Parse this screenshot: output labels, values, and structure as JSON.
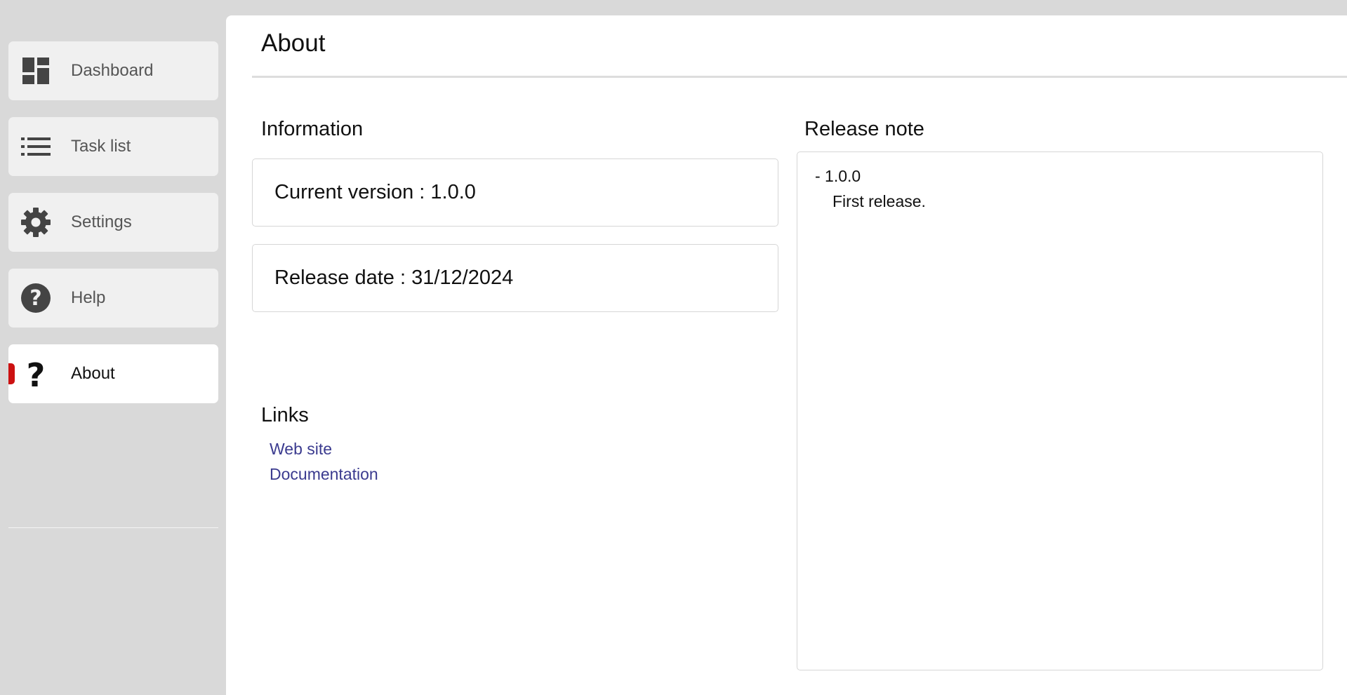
{
  "sidebar": {
    "items": [
      {
        "label": "Dashboard",
        "icon": "dashboard-icon",
        "active": false
      },
      {
        "label": "Task list",
        "icon": "list-icon",
        "active": false
      },
      {
        "label": "Settings",
        "icon": "gear-icon",
        "active": false
      },
      {
        "label": "Help",
        "icon": "help-circle-icon",
        "active": false
      },
      {
        "label": "About",
        "icon": "question-mark-icon",
        "active": true
      }
    ]
  },
  "page": {
    "title": "About"
  },
  "information": {
    "heading": "Information",
    "current_version": "Current version : 1.0.0",
    "release_date": "Release date : 31/12/2024"
  },
  "links": {
    "heading": "Links",
    "items": [
      {
        "label": "Web site"
      },
      {
        "label": "Documentation"
      }
    ]
  },
  "release_note": {
    "heading": "Release note",
    "version": "- 1.0.0",
    "text": "First release."
  },
  "colors": {
    "active_marker": "#cc1111",
    "link": "#3b3b8f",
    "sidebar_background": "#d9d9d9"
  }
}
